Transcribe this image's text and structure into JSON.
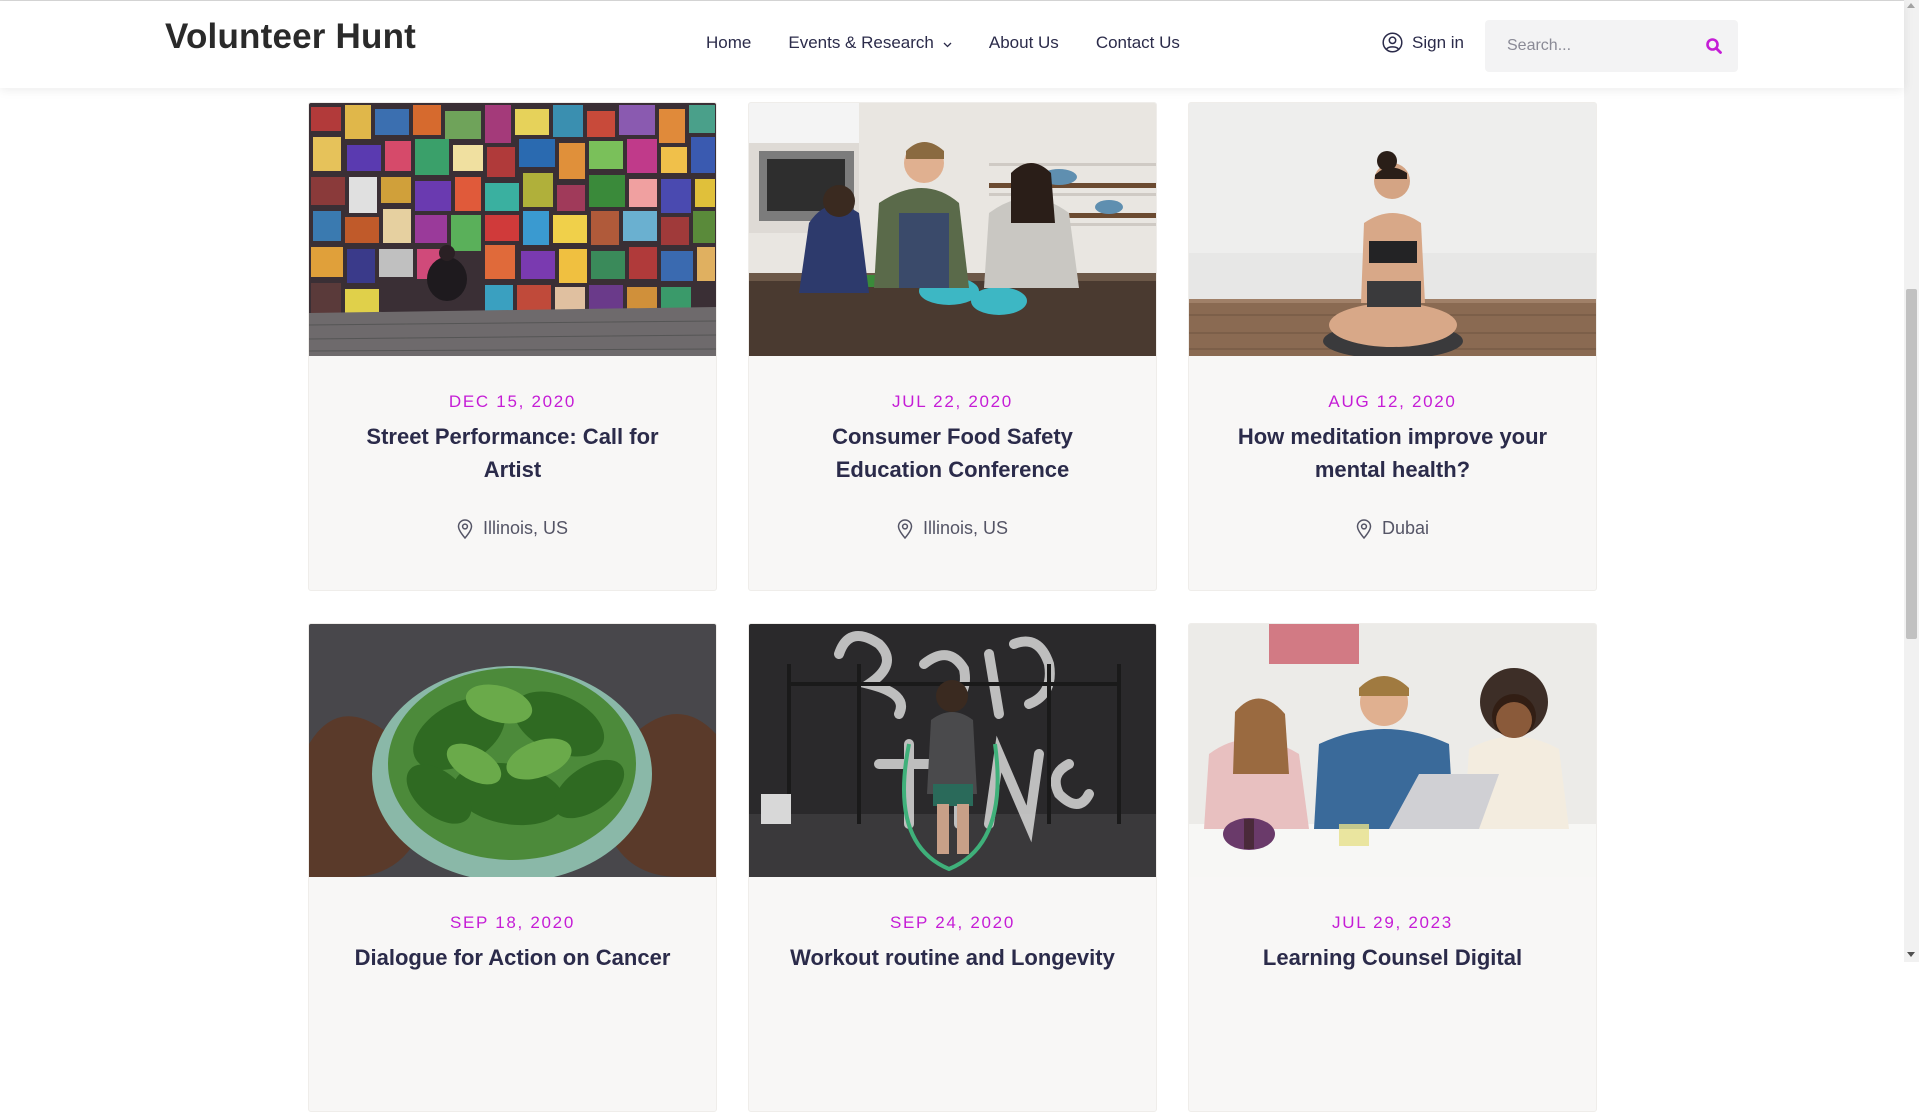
{
  "site": {
    "logo": "Volunteer Hunt",
    "accent_color": "#c51dd6",
    "text_color": "#2b2b4a"
  },
  "nav": {
    "items": [
      {
        "label": "Home"
      },
      {
        "label": "Events & Research",
        "has_dropdown": true
      },
      {
        "label": "About Us"
      },
      {
        "label": "Contact Us"
      }
    ]
  },
  "account": {
    "signin_label": "Sign in",
    "icon": "user-circle-icon"
  },
  "search": {
    "placeholder": "Search...",
    "value": "",
    "icon": "search-icon"
  },
  "events": [
    {
      "date": "DEC 15, 2020",
      "title": "Street Performance: Call for Artist",
      "location": "Illinois, US",
      "image": "artist-paintings-wall"
    },
    {
      "date": "JUL 22, 2020",
      "title": "Consumer Food Safety Education Conference",
      "location": "Illinois, US",
      "image": "people-cooking-kitchen"
    },
    {
      "date": "AUG 12, 2020",
      "title": "How meditation improve your mental health?",
      "location": "Dubai",
      "image": "woman-meditating"
    },
    {
      "date": "SEP 18, 2020",
      "title": "Dialogue for Action on Cancer",
      "location": "",
      "image": "bowl-of-spinach"
    },
    {
      "date": "SEP 24, 2020",
      "title": "Workout routine and Longevity",
      "location": "",
      "image": "woman-jumping-rope-gym"
    },
    {
      "date": "JUL 29, 2023",
      "title": "Learning Counsel Digital",
      "location": "",
      "image": "team-working-laptop"
    }
  ]
}
